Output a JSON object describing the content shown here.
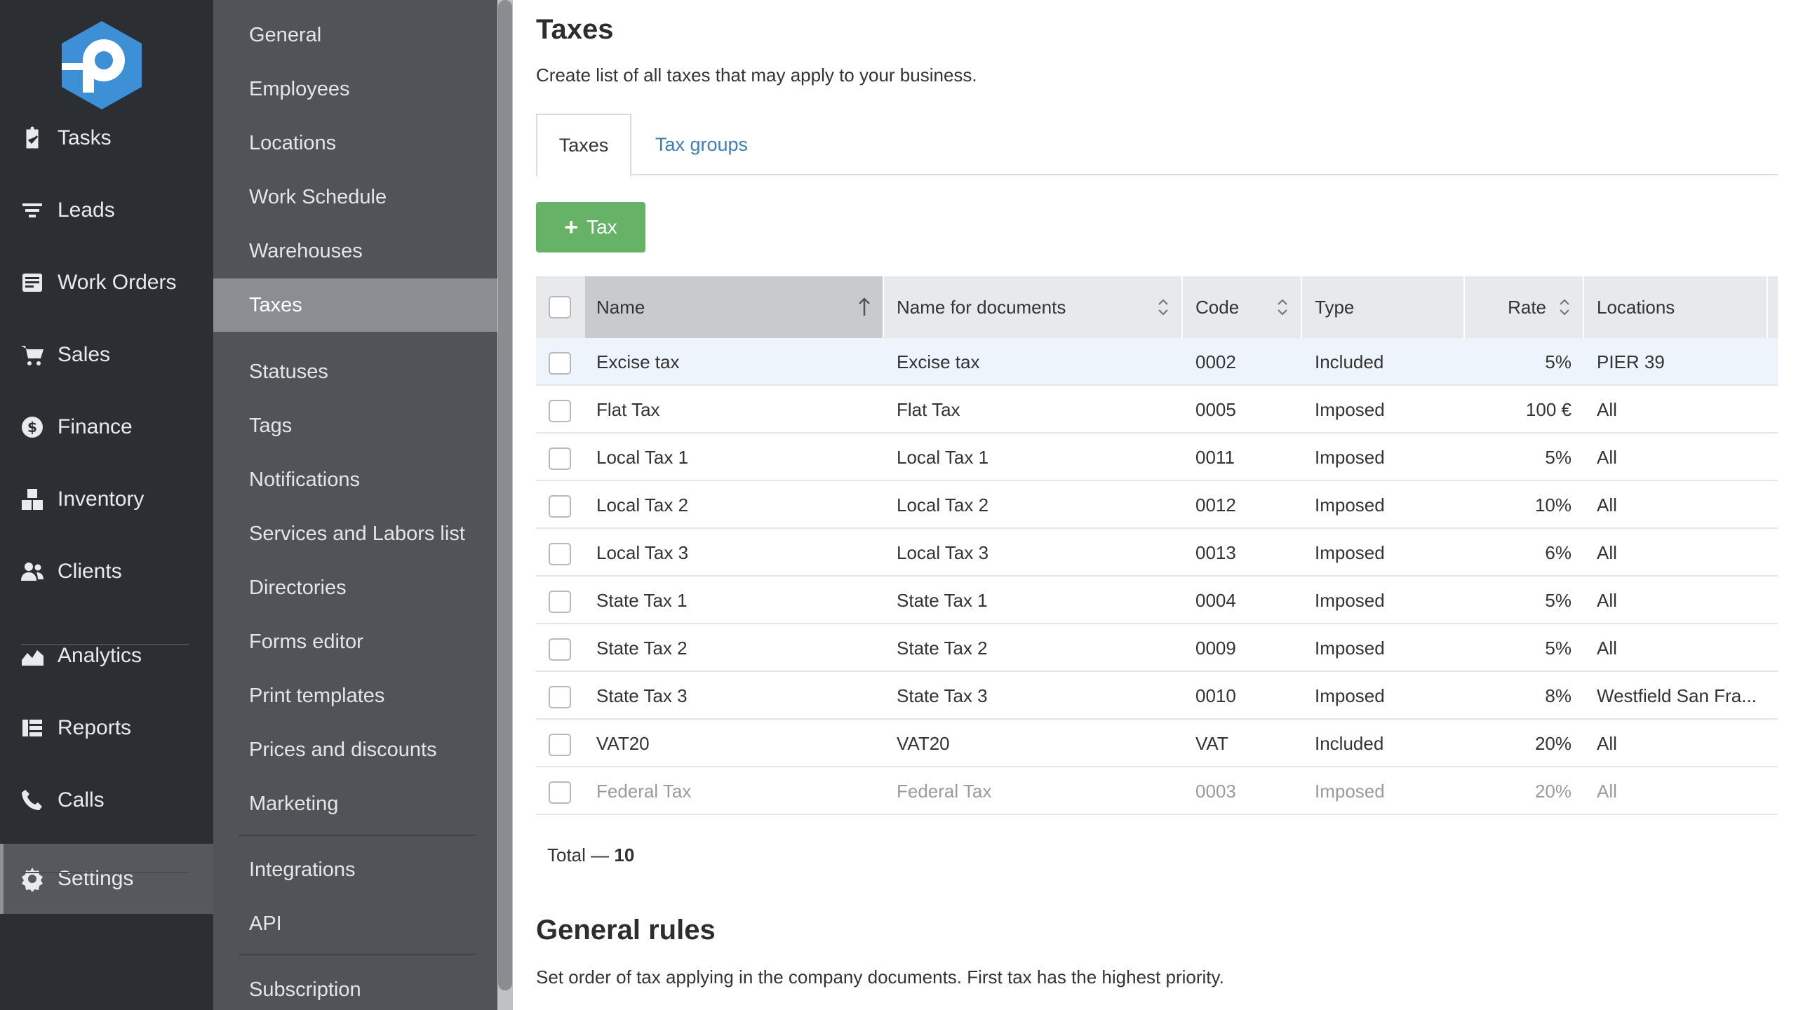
{
  "nav": {
    "items": [
      {
        "label": "Tasks",
        "icon": "clipboard-check-icon"
      },
      {
        "label": "Leads",
        "icon": "filter-icon"
      },
      {
        "label": "Work Orders",
        "icon": "work-order-icon"
      },
      {
        "label": "Sales",
        "icon": "cart-icon"
      },
      {
        "label": "Finance",
        "icon": "dollar-circle-icon"
      },
      {
        "label": "Inventory",
        "icon": "boxes-icon"
      },
      {
        "label": "Clients",
        "icon": "users-icon"
      },
      {
        "label": "Analytics",
        "icon": "chart-area-icon"
      },
      {
        "label": "Reports",
        "icon": "list-icon"
      },
      {
        "label": "Calls",
        "icon": "phone-icon"
      },
      {
        "label": "Settings",
        "icon": "gear-icon"
      }
    ],
    "active": "Settings",
    "colors": {
      "bg": "#2b2e33",
      "active_bg": "#55585d",
      "logo": "#3d8fd6"
    }
  },
  "submenu": {
    "items": [
      "General",
      "Employees",
      "Locations",
      "Work Schedule",
      "Warehouses",
      "Taxes",
      "Statuses",
      "Tags",
      "Notifications",
      "Services and Labors list",
      "Directories",
      "Forms editor",
      "Print templates",
      "Prices and discounts",
      "Marketing",
      "Integrations",
      "API",
      "Subscription"
    ],
    "active": "Taxes"
  },
  "page": {
    "title": "Taxes",
    "description": "Create list of all taxes that may apply to your business."
  },
  "tabs": [
    {
      "label": "Taxes",
      "active": true
    },
    {
      "label": "Tax groups",
      "active": false
    }
  ],
  "add_button": {
    "label": "Tax",
    "color": "#66b266"
  },
  "table": {
    "columns": [
      {
        "label": "Name",
        "sort": "asc"
      },
      {
        "label": "Name for documents",
        "sort": "both"
      },
      {
        "label": "Code",
        "sort": "both"
      },
      {
        "label": "Type",
        "sort": "none"
      },
      {
        "label": "Rate",
        "sort": "both"
      },
      {
        "label": "Locations",
        "sort": "none"
      }
    ],
    "rows": [
      {
        "name": "Excise tax",
        "doc_name": "Excise tax",
        "code": "0002",
        "type": "Included",
        "rate": "5%",
        "locations": "PIER 39",
        "highlighted": true
      },
      {
        "name": "Flat Tax",
        "doc_name": "Flat Tax",
        "code": "0005",
        "type": "Imposed",
        "rate": "100 €",
        "locations": "All"
      },
      {
        "name": "Local Tax 1",
        "doc_name": "Local Tax 1",
        "code": "0011",
        "type": "Imposed",
        "rate": "5%",
        "locations": "All"
      },
      {
        "name": "Local Tax 2",
        "doc_name": "Local Tax 2",
        "code": "0012",
        "type": "Imposed",
        "rate": "10%",
        "locations": "All"
      },
      {
        "name": "Local Tax 3",
        "doc_name": "Local Tax 3",
        "code": "0013",
        "type": "Imposed",
        "rate": "6%",
        "locations": "All"
      },
      {
        "name": "State Tax 1",
        "doc_name": "State Tax 1",
        "code": "0004",
        "type": "Imposed",
        "rate": "5%",
        "locations": "All"
      },
      {
        "name": "State Tax 2",
        "doc_name": "State Tax 2",
        "code": "0009",
        "type": "Imposed",
        "rate": "5%",
        "locations": "All"
      },
      {
        "name": "State Tax 3",
        "doc_name": "State Tax 3",
        "code": "0010",
        "type": "Imposed",
        "rate": "8%",
        "locations": "Westfield San Fra..."
      },
      {
        "name": "VAT20",
        "doc_name": "VAT20",
        "code": "VAT",
        "type": "Included",
        "rate": "20%",
        "locations": "All"
      },
      {
        "name": "Federal Tax",
        "doc_name": "Federal Tax",
        "code": "0003",
        "type": "Imposed",
        "rate": "20%",
        "locations": "All",
        "muted": true
      }
    ],
    "total_label": "Total — ",
    "total_value": "10"
  },
  "rules": {
    "title": "General rules",
    "description": "Set order of tax applying in the company documents. First tax has the highest priority."
  }
}
